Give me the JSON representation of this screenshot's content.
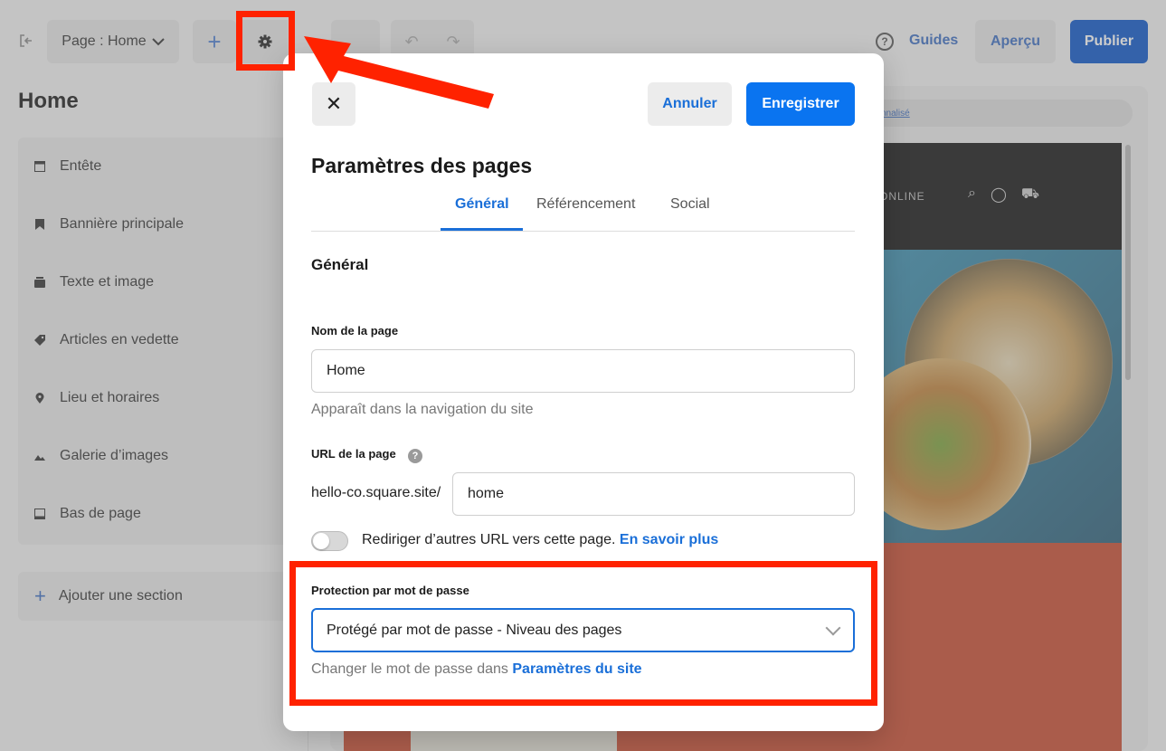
{
  "topbar": {
    "page_select_label": "Page : Home",
    "add_label": "+",
    "guides_label": "Guides",
    "preview_label": "Aperçu",
    "publish_label": "Publier"
  },
  "sidebar": {
    "title": "Home",
    "sections": [
      {
        "label": "Entête",
        "icon": "header-icon"
      },
      {
        "label": "Bannière principale",
        "icon": "bookmark-icon"
      },
      {
        "label": "Texte et image",
        "icon": "text-image-icon"
      },
      {
        "label": "Articles en vedette",
        "icon": "tag-icon"
      },
      {
        "label": "Lieu et horaires",
        "icon": "location-pin-icon"
      },
      {
        "label": "Galerie d’images",
        "icon": "image-gallery-icon"
      },
      {
        "label": "Bas de page",
        "icon": "footer-icon"
      }
    ],
    "add_section_label": "Ajouter une section"
  },
  "preview": {
    "url_strip_text": "nnalisé",
    "order_text": "R ONLINE"
  },
  "modal": {
    "cancel_label": "Annuler",
    "save_label": "Enregistrer",
    "title": "Paramètres des pages",
    "tabs": [
      {
        "label": "Général",
        "active": true
      },
      {
        "label": "Référencement",
        "active": false
      },
      {
        "label": "Social",
        "active": false
      }
    ],
    "section_heading": "Général",
    "page_name": {
      "label": "Nom de la page",
      "value": "Home",
      "help": "Apparaît dans la navigation du site"
    },
    "page_url": {
      "label": "URL de la page",
      "prefix": "hello-co.square.site/",
      "value": "home"
    },
    "redirect": {
      "label": "Rediriger d’autres URL vers cette page.",
      "link": "En savoir plus",
      "enabled": false
    },
    "password": {
      "label": "Protection par mot de passe",
      "selected": "Protégé par mot de passe - Niveau des pages",
      "help_prefix": "Changer le mot de passe dans",
      "help_link": "Paramètres du site"
    }
  },
  "colors": {
    "accent": "#1a6fd8",
    "publish": "#0a55c9",
    "highlight": "#ff2200"
  }
}
